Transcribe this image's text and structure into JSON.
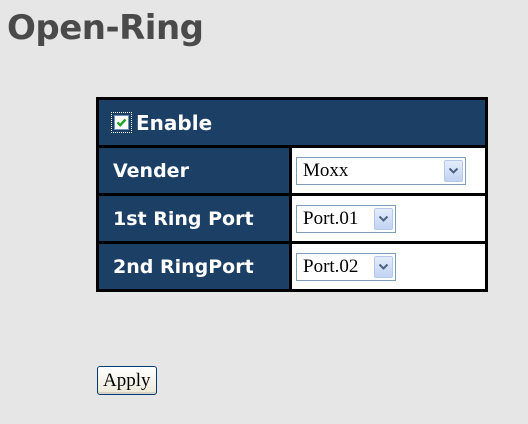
{
  "page": {
    "title": "Open-Ring"
  },
  "form": {
    "enable": {
      "label": "Enable",
      "checked": true
    },
    "vender": {
      "label": "Vender",
      "value": "Moxx"
    },
    "ring_port_1": {
      "label": "1st Ring Port",
      "value": "Port.01"
    },
    "ring_port_2": {
      "label": "2nd RingPort",
      "value": "Port.02"
    }
  },
  "actions": {
    "apply_label": "Apply"
  },
  "colors": {
    "background": "#e6e6e6",
    "header_blue": "#1c3f66",
    "title_gray": "#4a4a4a"
  },
  "icons": {
    "checkbox": "checkmark-icon",
    "dropdown": "chevron-down-icon"
  }
}
